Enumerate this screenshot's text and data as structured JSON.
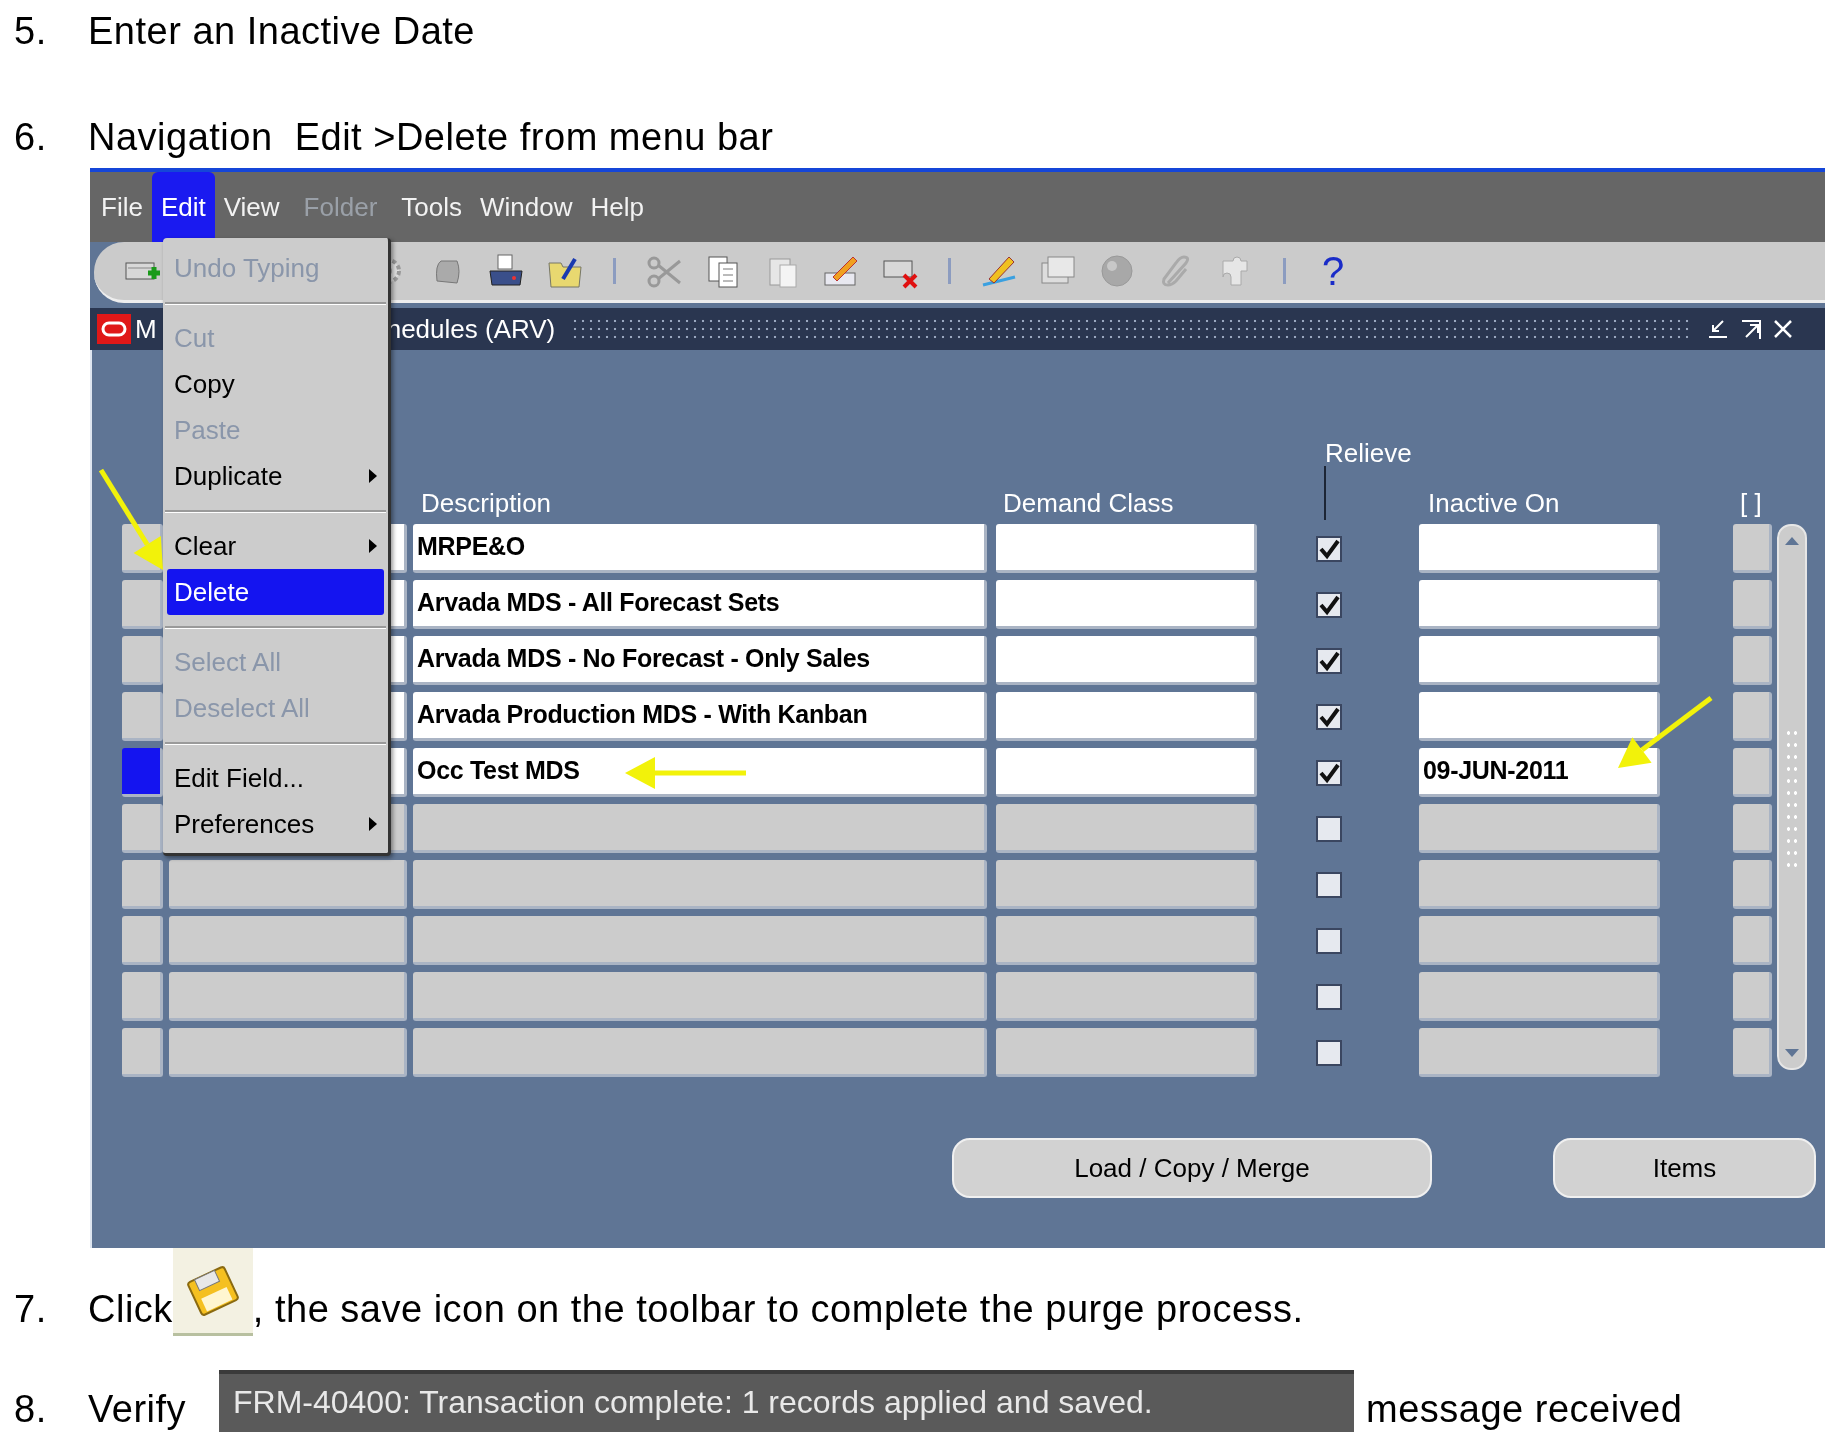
{
  "steps_before": [
    {
      "number": "5.",
      "text": "Enter an Inactive Date"
    },
    {
      "number": "6.",
      "text": "Navigation  Edit >Delete from menu bar"
    }
  ],
  "app": {
    "menu_bar": [
      {
        "label": "File",
        "selected": false,
        "disabled": false
      },
      {
        "label": "Edit",
        "selected": true,
        "disabled": false
      },
      {
        "label": "View",
        "selected": false,
        "disabled": false
      },
      {
        "label": "Folder",
        "selected": false,
        "disabled": true
      },
      {
        "label": "Tools",
        "selected": false,
        "disabled": false
      },
      {
        "label": "Window",
        "selected": false,
        "disabled": false
      },
      {
        "label": "Help",
        "selected": false,
        "disabled": false
      }
    ],
    "toolbar": {
      "help_label": "?"
    },
    "window_title": {
      "visible_start": "M",
      "visible_end": "hedules (ARV)"
    },
    "edit_menu": [
      {
        "kind": "item",
        "label": "Undo Typing",
        "disabled": true,
        "submenu": false,
        "selected": false
      },
      {
        "kind": "separator"
      },
      {
        "kind": "item",
        "label": "Cut",
        "disabled": true,
        "submenu": false,
        "selected": false
      },
      {
        "kind": "item",
        "label": "Copy",
        "disabled": false,
        "submenu": false,
        "selected": false
      },
      {
        "kind": "item",
        "label": "Paste",
        "disabled": true,
        "submenu": false,
        "selected": false
      },
      {
        "kind": "item",
        "label": "Duplicate",
        "disabled": false,
        "submenu": true,
        "selected": false
      },
      {
        "kind": "separator"
      },
      {
        "kind": "item",
        "label": "Clear",
        "disabled": false,
        "submenu": true,
        "selected": false
      },
      {
        "kind": "item",
        "label": "Delete",
        "disabled": false,
        "submenu": false,
        "selected": true
      },
      {
        "kind": "separator"
      },
      {
        "kind": "item",
        "label": "Select All",
        "disabled": true,
        "submenu": false,
        "selected": false
      },
      {
        "kind": "item",
        "label": "Deselect All",
        "disabled": true,
        "submenu": false,
        "selected": false
      },
      {
        "kind": "separator"
      },
      {
        "kind": "item",
        "label": "Edit Field...",
        "disabled": false,
        "submenu": false,
        "selected": false
      },
      {
        "kind": "item",
        "label": "Preferences",
        "disabled": false,
        "submenu": true,
        "selected": false
      }
    ],
    "columns": {
      "description": "Description",
      "demand_class": "Demand Class",
      "relieve": "Relieve",
      "inactive_on": "Inactive On",
      "column_6": "[ ]"
    },
    "rows": [
      {
        "kind": "record",
        "current": false,
        "description": "MRPE&O",
        "relieve": true
      },
      {
        "kind": "record",
        "current": false,
        "description": "Arvada MDS - All Forecast Sets",
        "relieve": true
      },
      {
        "kind": "record",
        "current": false,
        "description": "Arvada MDS - No Forecast - Only Sales",
        "relieve": true
      },
      {
        "kind": "record",
        "current": false,
        "description": "Arvada Production MDS - With Kanban",
        "relieve": true
      },
      {
        "kind": "record",
        "current": true,
        "description": "Occ Test MDS",
        "relieve": true,
        "inactive_on": "09-JUN-2011"
      },
      {
        "kind": "empty",
        "current": false,
        "relieve": false
      },
      {
        "kind": "empty",
        "current": false,
        "relieve": false
      },
      {
        "kind": "empty",
        "current": false,
        "relieve": false
      },
      {
        "kind": "empty",
        "current": false,
        "relieve": false
      },
      {
        "kind": "empty",
        "current": false,
        "relieve": false
      }
    ],
    "buttons": [
      "Load / Copy / Merge",
      "Items"
    ]
  },
  "step_7": {
    "number": "7.",
    "before": "Click",
    "after": ", the save icon on the toolbar to complete the purge process."
  },
  "step_8": {
    "number": "8.",
    "before": "Verify",
    "message": "FRM-40400: Transaction complete: 1 records applied and saved.",
    "after": "message received"
  }
}
